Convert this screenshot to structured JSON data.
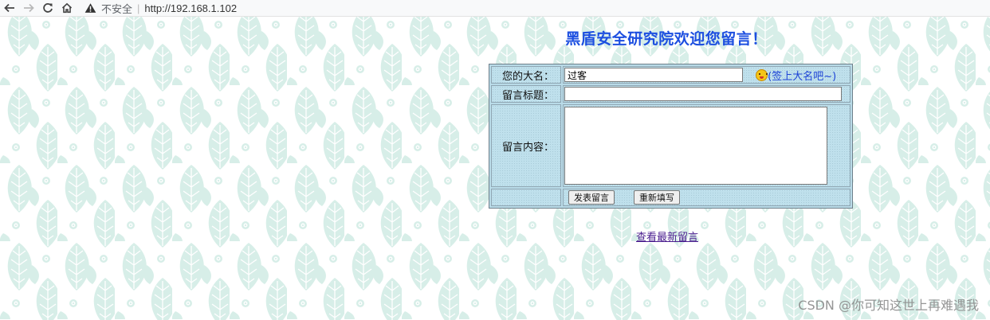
{
  "browser": {
    "security_label": "不安全",
    "url": "http://192.168.1.102"
  },
  "page": {
    "title": "黑盾安全研究院欢迎您留言！",
    "form": {
      "name_label": "您的大名：",
      "name_value": "过客",
      "name_hint": "(签上大名吧~)",
      "subject_label": "留言标题：",
      "subject_value": "",
      "content_label": "留言内容：",
      "content_value": "",
      "submit_label": "发表留言",
      "reset_label": "重新填写"
    },
    "latest_link": "查看最新留言"
  },
  "watermark": "CSDN @你可知这世上再难遇我",
  "colors": {
    "title": "#1d4fe0",
    "table_bg": "#bfe0ec",
    "link": "#4b1e8f",
    "leaf": "#d4ece6"
  }
}
